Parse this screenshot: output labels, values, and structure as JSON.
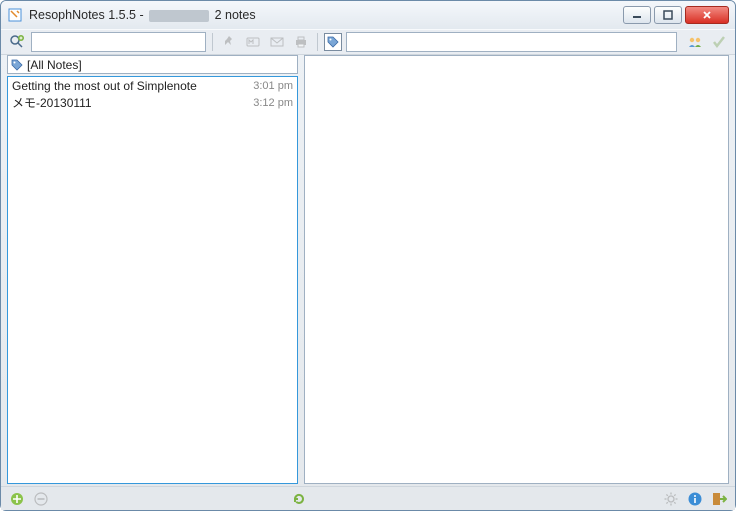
{
  "window": {
    "title_prefix": "ResophNotes 1.5.5 - ",
    "title_suffix": " 2 notes"
  },
  "toolbar": {
    "search_value": "",
    "tag_value": ""
  },
  "filter": {
    "label": "[All Notes]"
  },
  "notes": [
    {
      "title": "Getting the most out of Simplenote",
      "time": "3:01 pm"
    },
    {
      "title": "メモ-20130111",
      "time": "3:12 pm"
    }
  ],
  "editor": {
    "content": ""
  }
}
